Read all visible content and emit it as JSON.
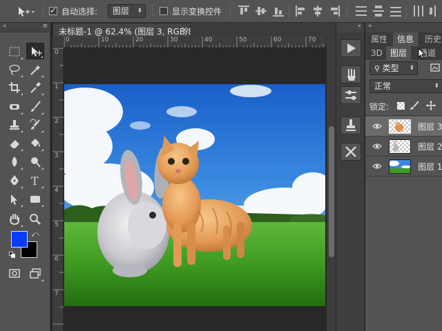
{
  "options_bar": {
    "auto_select_label": "自动选择:",
    "auto_select_checked": true,
    "auto_select_target": "图层",
    "show_transform_label": "显示变换控件",
    "show_transform_checked": false
  },
  "document": {
    "tab_title": "未标题-1 @ 62.4% (图层 3, RGB/8) *",
    "close_glyph": "×",
    "ruler_top": [
      "0",
      "10",
      "20",
      "30",
      "40",
      "50",
      "60",
      "70"
    ],
    "ruler_left": [
      "0",
      "1",
      "2",
      "3",
      "4",
      "5",
      "6",
      "7"
    ],
    "zoom": "62.4%"
  },
  "colors": {
    "foreground": "#0a3cff",
    "background": "#000000",
    "ui_dark": "#535353",
    "selected_layer": "#6a6a6a"
  },
  "panels": {
    "top_tabs": [
      "属性",
      "信息",
      "历史"
    ],
    "active_top_tab": "信息",
    "second_tabs": [
      "3D",
      "图层",
      "通道"
    ],
    "active_second_tab": "图层",
    "filter_label": "类型",
    "blend_mode": "正常",
    "lock_label": "锁定:",
    "layers": [
      {
        "name": "图层 3",
        "visible": true,
        "selected": true,
        "thumb": "cat"
      },
      {
        "name": "图层 2",
        "visible": true,
        "selected": false,
        "thumb": "rabbit"
      },
      {
        "name": "图层 1",
        "visible": true,
        "selected": false,
        "thumb": "landscape"
      }
    ]
  },
  "icons": {
    "tools": [
      "rect-marquee",
      "move",
      "lasso",
      "magic-wand",
      "crop",
      "eyedropper",
      "spot-healing",
      "brush",
      "clone-stamp",
      "history-brush",
      "eraser",
      "paint-bucket",
      "blur",
      "dodge",
      "pen",
      "type",
      "path-select",
      "rectangle-shape",
      "hand",
      "zoom",
      "quick-mask",
      "screen-mode"
    ]
  }
}
